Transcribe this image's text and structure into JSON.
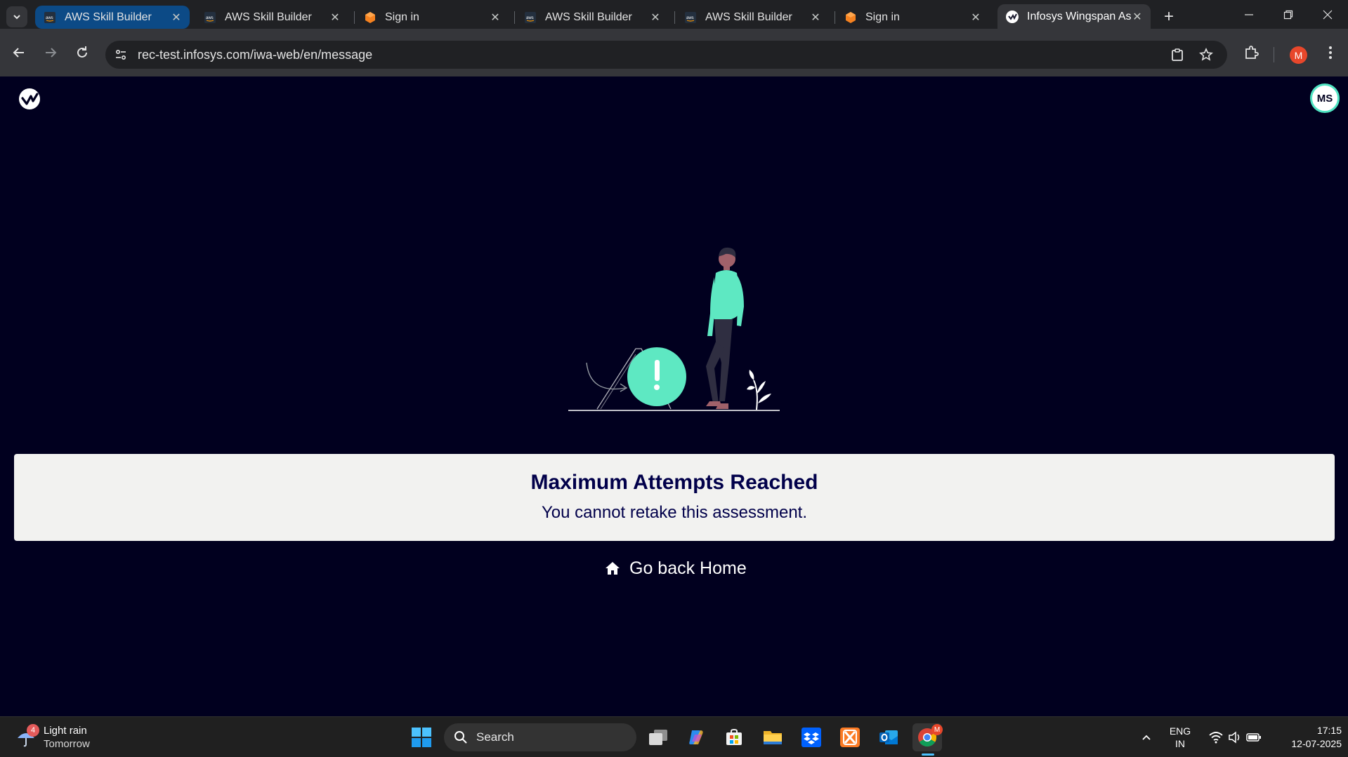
{
  "browser": {
    "tabs": [
      {
        "label": "AWS Skill Builder",
        "favicon": "aws-logo",
        "active": false
      },
      {
        "label": "AWS Skill Builder",
        "favicon": "aws-logo",
        "active": false
      },
      {
        "label": "Sign in",
        "favicon": "orange-cube-logo",
        "active": false
      },
      {
        "label": "AWS Skill Builder",
        "favicon": "aws-logo",
        "active": false
      },
      {
        "label": "AWS Skill Builder",
        "favicon": "aws-logo",
        "active": false
      },
      {
        "label": "Sign in",
        "favicon": "orange-cube-logo",
        "active": false
      },
      {
        "label": "Infosys Wingspan As",
        "favicon": "wingspan-logo",
        "active": true
      }
    ],
    "url": "rec-test.infosys.com/iwa-web/en/message",
    "profile_initial": "M",
    "colors": {
      "tabstrip": "#202124",
      "toolbar": "#35363a",
      "active_tab": "#0f4d8a"
    }
  },
  "page": {
    "user_initials": "MS",
    "message_title": "Maximum Attempts Reached",
    "message_subtitle": "You cannot retake this assessment.",
    "go_home_label": "Go back Home",
    "colors": {
      "background": "#01001f",
      "accent": "#50e3c2",
      "card": "#f2f2f0",
      "title_text": "#01004a"
    }
  },
  "taskbar": {
    "weather": {
      "badge": "4",
      "condition": "Light rain",
      "when": "Tomorrow"
    },
    "search_placeholder": "Search",
    "language": {
      "line1": "ENG",
      "line2": "IN"
    },
    "clock": {
      "time": "17:15",
      "date": "12-07-2025"
    },
    "chrome_badge": "M",
    "apps": [
      "task-view-icon",
      "copilot-icon",
      "store-icon",
      "file-explorer-icon",
      "dropbox-icon",
      "xampp-icon",
      "outlook-icon",
      "chrome-icon"
    ]
  }
}
